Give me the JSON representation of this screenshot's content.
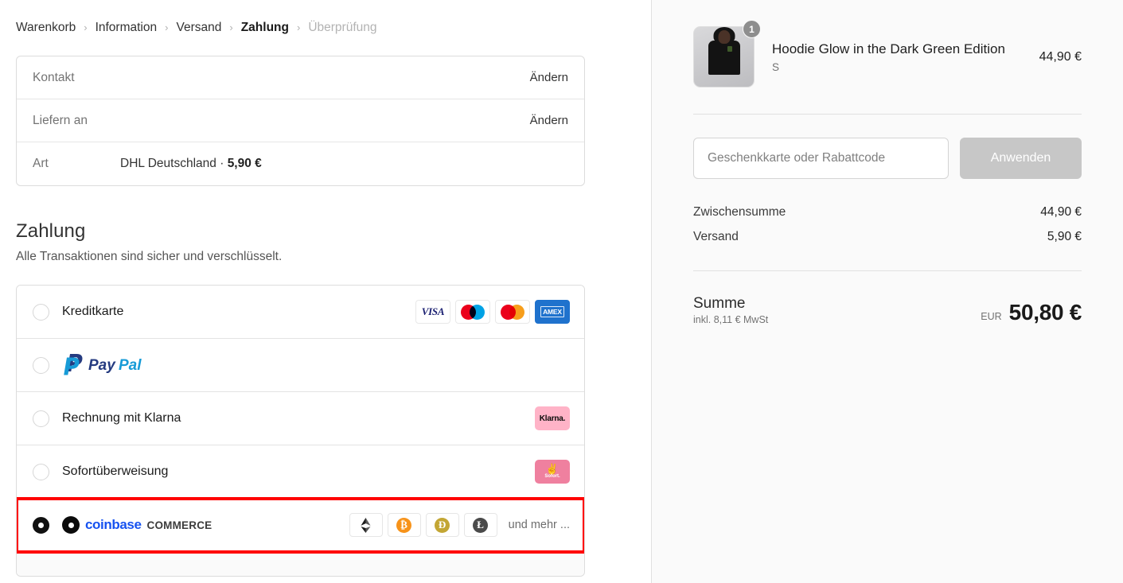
{
  "breadcrumb": {
    "separator": "›",
    "items": [
      {
        "label": "Warenkorb",
        "state": "done"
      },
      {
        "label": "Information",
        "state": "done"
      },
      {
        "label": "Versand",
        "state": "done"
      },
      {
        "label": "Zahlung",
        "state": "current"
      },
      {
        "label": "Überprüfung",
        "state": "future"
      }
    ]
  },
  "review": {
    "rows": [
      {
        "label": "Kontakt",
        "value": "",
        "action": "Ändern"
      },
      {
        "label": "Liefern an",
        "value": "",
        "action": "Ändern"
      },
      {
        "label": "Art",
        "value_prefix": "DHL Deutschland · ",
        "value_strong": "5,90 €",
        "action": ""
      }
    ]
  },
  "payment": {
    "title": "Zahlung",
    "subtitle": "Alle Transaktionen sind sicher und verschlüsselt.",
    "methods": [
      {
        "id": "credit-card",
        "label": "Kreditkarte",
        "selected": false,
        "brands": [
          "VISA",
          "Maestro",
          "Mastercard",
          "AMEX"
        ],
        "visa_text": "VISA",
        "amex_text": "AMEX"
      },
      {
        "id": "paypal",
        "label": "PayPal",
        "logo_text_1": "Pay",
        "logo_text_2": "Pal",
        "selected": false
      },
      {
        "id": "klarna",
        "label": "Rechnung mit Klarna",
        "badge_text": "Klarna.",
        "badge_color": "#ffb3c7",
        "selected": false
      },
      {
        "id": "sofort",
        "label": "Sofortüberweisung",
        "badge_text": "Sofort.",
        "badge_icon": "peace-hand-icon",
        "badge_color": "#ef809f",
        "selected": false
      },
      {
        "id": "coinbase-commerce",
        "label": "coinbase COMMERCE",
        "logo_brand": "coinbase",
        "logo_suffix": "COMMERCE",
        "selected": true,
        "highlighted": true,
        "coins": [
          {
            "name": "Ethereum",
            "symbol": "Ξ",
            "color": "#3c3c3d",
            "plain": true
          },
          {
            "name": "Bitcoin",
            "symbol": "Ƀ",
            "color": "#f7931a",
            "plain": false
          },
          {
            "name": "Dogecoin",
            "symbol": "Ð",
            "color": "#c3a634",
            "plain": false
          },
          {
            "name": "Litecoin",
            "symbol": "Ł",
            "color": "#4a4a4a",
            "plain": false
          }
        ],
        "more_text": "und mehr ..."
      }
    ]
  },
  "summary": {
    "line_item": {
      "title": "Hoodie Glow in the Dark Green Edition",
      "variant": "S",
      "quantity": "1",
      "price": "44,90 €",
      "image_alt": "person-wearing-black-hoodie"
    },
    "discount": {
      "placeholder": "Geschenkkarte oder Rabattcode",
      "value": "",
      "apply_label": "Anwenden",
      "apply_disabled": true
    },
    "totals": [
      {
        "label": "Zwischensumme",
        "value": "44,90 €"
      },
      {
        "label": "Versand",
        "value": "5,90 €"
      }
    ],
    "grand_total": {
      "label": "Summe",
      "note": "inkl. 8,11 € MwSt",
      "currency": "EUR",
      "amount": "50,80 €"
    }
  },
  "colors": {
    "highlight": "#ff0000",
    "coinbase_blue": "#1652f0",
    "paypal_dark": "#253b80",
    "paypal_light": "#179bd7",
    "klarna_pink": "#ffb3c7",
    "sofort_pink": "#ef809f",
    "amex_blue": "#1f72cd",
    "visa_blue": "#1a1f71",
    "panel_bg": "#fafafa"
  }
}
